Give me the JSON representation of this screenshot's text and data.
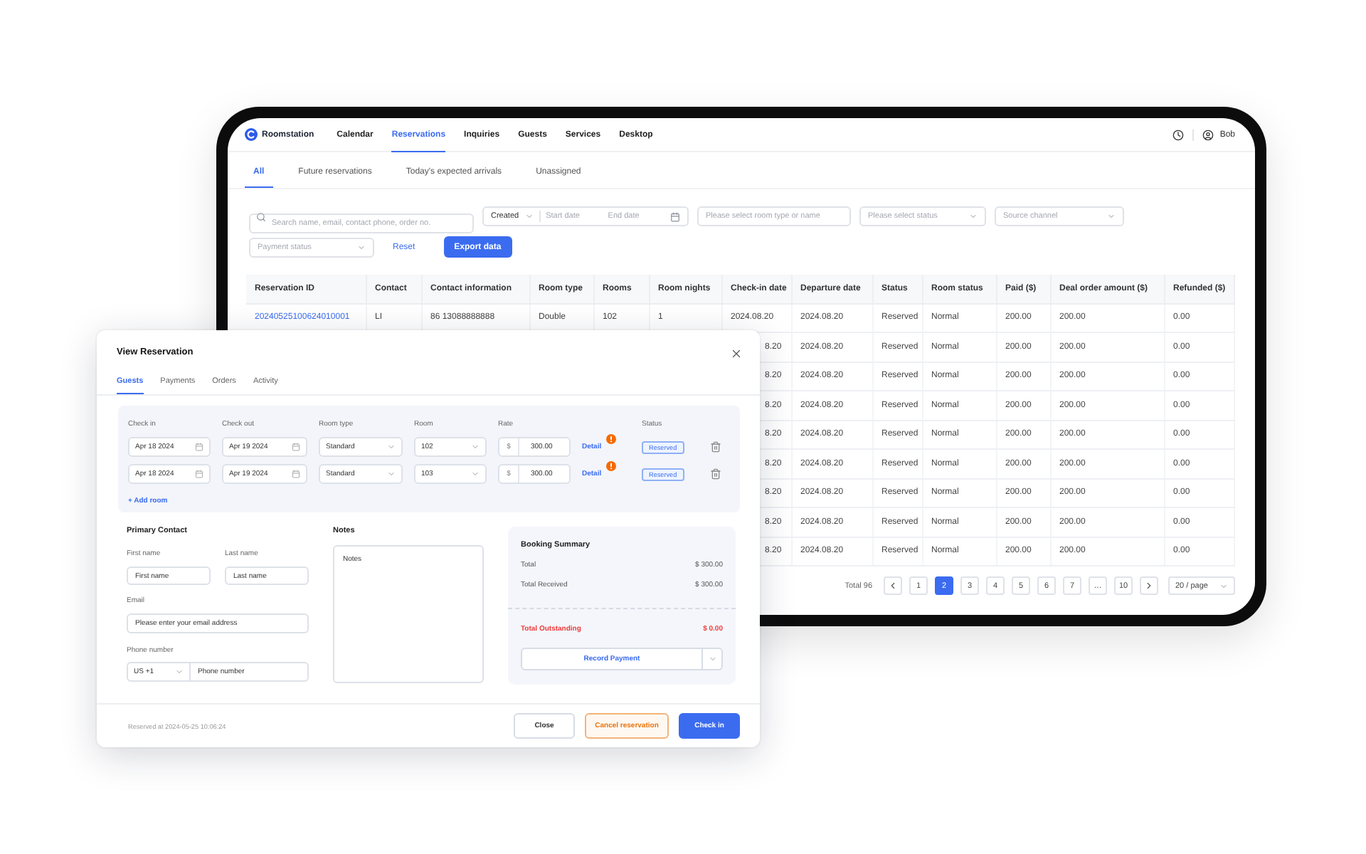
{
  "app": {
    "brand": "Roomstation",
    "nav": [
      {
        "label": "Calendar",
        "selected": false
      },
      {
        "label": "Reservations",
        "selected": true
      },
      {
        "label": "Inquiries",
        "selected": false
      },
      {
        "label": "Guests",
        "selected": false
      },
      {
        "label": "Services",
        "selected": false
      },
      {
        "label": "Desktop",
        "selected": false
      }
    ],
    "user": "Bob"
  },
  "subtabs": [
    {
      "label": "All",
      "selected": true
    },
    {
      "label": "Future reservations",
      "selected": false
    },
    {
      "label": "Today's expected arrivals",
      "selected": false
    },
    {
      "label": "Unassigned",
      "selected": false
    }
  ],
  "filters": {
    "search": {
      "placeholder": "Search name, email, contact phone, order no."
    },
    "date_range": {
      "type": "Created",
      "start_placeholder": "Start date",
      "end_placeholder": "End date"
    },
    "room": {
      "placeholder": "Please select room type or name"
    },
    "status": {
      "placeholder": "Please select status"
    },
    "channel": {
      "placeholder": "Source channel"
    },
    "payment": {
      "placeholder": "Payment status"
    },
    "reset": "Reset",
    "export": "Export data"
  },
  "table": {
    "columns": [
      "Reservation ID",
      "Contact",
      "Contact information",
      "Room type",
      "Rooms",
      "Room nights",
      "Check-in date",
      "Departure date",
      "Status",
      "Room status",
      "Paid ($)",
      "Deal order amount ($)",
      "Refunded ($)"
    ],
    "rows": [
      {
        "cells": [
          "20240525100624010001",
          "LI",
          "86 13088888888",
          "Double",
          "102",
          "1",
          "2024.08.20",
          "2024.08.20",
          "Reserved",
          "Normal",
          "200.00",
          "200.00",
          "0.00"
        ]
      },
      {
        "cells": [
          "8.20",
          "2024.08.20",
          "Reserved",
          "Normal",
          "200.00",
          "200.00",
          "0.00"
        ]
      },
      {
        "cells": [
          "8.20",
          "2024.08.20",
          "Reserved",
          "Normal",
          "200.00",
          "200.00",
          "0.00"
        ]
      },
      {
        "cells": [
          "8.20",
          "2024.08.20",
          "Reserved",
          "Normal",
          "200.00",
          "200.00",
          "0.00"
        ]
      },
      {
        "cells": [
          "8.20",
          "2024.08.20",
          "Reserved",
          "Normal",
          "200.00",
          "200.00",
          "0.00"
        ]
      },
      {
        "cells": [
          "8.20",
          "2024.08.20",
          "Reserved",
          "Normal",
          "200.00",
          "200.00",
          "0.00"
        ]
      },
      {
        "cells": [
          "8.20",
          "2024.08.20",
          "Reserved",
          "Normal",
          "200.00",
          "200.00",
          "0.00"
        ]
      },
      {
        "cells": [
          "8.20",
          "2024.08.20",
          "Reserved",
          "Normal",
          "200.00",
          "200.00",
          "0.00"
        ]
      },
      {
        "cells": [
          "8.20",
          "2024.08.20",
          "Reserved",
          "Normal",
          "200.00",
          "200.00",
          "0.00"
        ]
      }
    ]
  },
  "pagination": {
    "total": "Total 96",
    "pages": [
      {
        "kind": "prev",
        "selected": false
      },
      {
        "kind": "page",
        "label": "1",
        "selected": false
      },
      {
        "kind": "page",
        "label": "2",
        "selected": true
      },
      {
        "kind": "page",
        "label": "3",
        "selected": false
      },
      {
        "kind": "page",
        "label": "4",
        "selected": false
      },
      {
        "kind": "page",
        "label": "5",
        "selected": false
      },
      {
        "kind": "page",
        "label": "6",
        "selected": false
      },
      {
        "kind": "page",
        "label": "7",
        "selected": false
      },
      {
        "kind": "ellipsis",
        "label": "…",
        "selected": false
      },
      {
        "kind": "page",
        "label": "10",
        "selected": false
      },
      {
        "kind": "next",
        "selected": false
      }
    ],
    "page_size": "20 / page"
  },
  "modal": {
    "title": "View Reservation",
    "tabs": [
      {
        "label": "Guests",
        "selected": true
      },
      {
        "label": "Payments",
        "selected": false
      },
      {
        "label": "Orders",
        "selected": false
      },
      {
        "label": "Activity",
        "selected": false
      }
    ],
    "rooms": {
      "columns": [
        "Check in",
        "Check out",
        "Room type",
        "Room",
        "Rate",
        "Status"
      ],
      "rows": [
        {
          "check_in": "Apr 18 2024",
          "check_out": "Apr 19 2024",
          "room_type": "Standard",
          "room": "102",
          "currency": "$",
          "rate": "300.00",
          "link": "Detail",
          "status": "Reserved"
        },
        {
          "check_in": "Apr 18 2024",
          "check_out": "Apr 19 2024",
          "room_type": "Standard",
          "room": "103",
          "currency": "$",
          "rate": "300.00",
          "link": "Detail",
          "status": "Reserved"
        }
      ],
      "add": "+ Add room"
    },
    "contact": {
      "title": "Primary Contact",
      "first_name": {
        "label": "First name",
        "placeholder": "First name"
      },
      "last_name": {
        "label": "Last name",
        "placeholder": "Last name"
      },
      "email": {
        "label": "Email",
        "placeholder": "Please enter your email address"
      },
      "phone": {
        "label": "Phone number",
        "country": "US +1",
        "placeholder": "Phone number"
      }
    },
    "notes": {
      "label": "Notes",
      "placeholder": "Notes"
    },
    "summary": {
      "title": "Booking Summary",
      "lines": [
        {
          "label": "Total",
          "value": "$ 300.00"
        },
        {
          "label": "Total Received",
          "value": "$ 300.00"
        }
      ],
      "outstanding": {
        "label": "Total Outstanding",
        "value": "$ 0.00"
      },
      "action": "Record Payment"
    },
    "footer": {
      "note": "Reserved at 2024-05-25 10:06:24",
      "buttons": [
        {
          "label": "Close",
          "kind": "default"
        },
        {
          "label": "Cancel reservation",
          "kind": "warning"
        },
        {
          "label": "Check in",
          "kind": "primary"
        }
      ]
    }
  }
}
